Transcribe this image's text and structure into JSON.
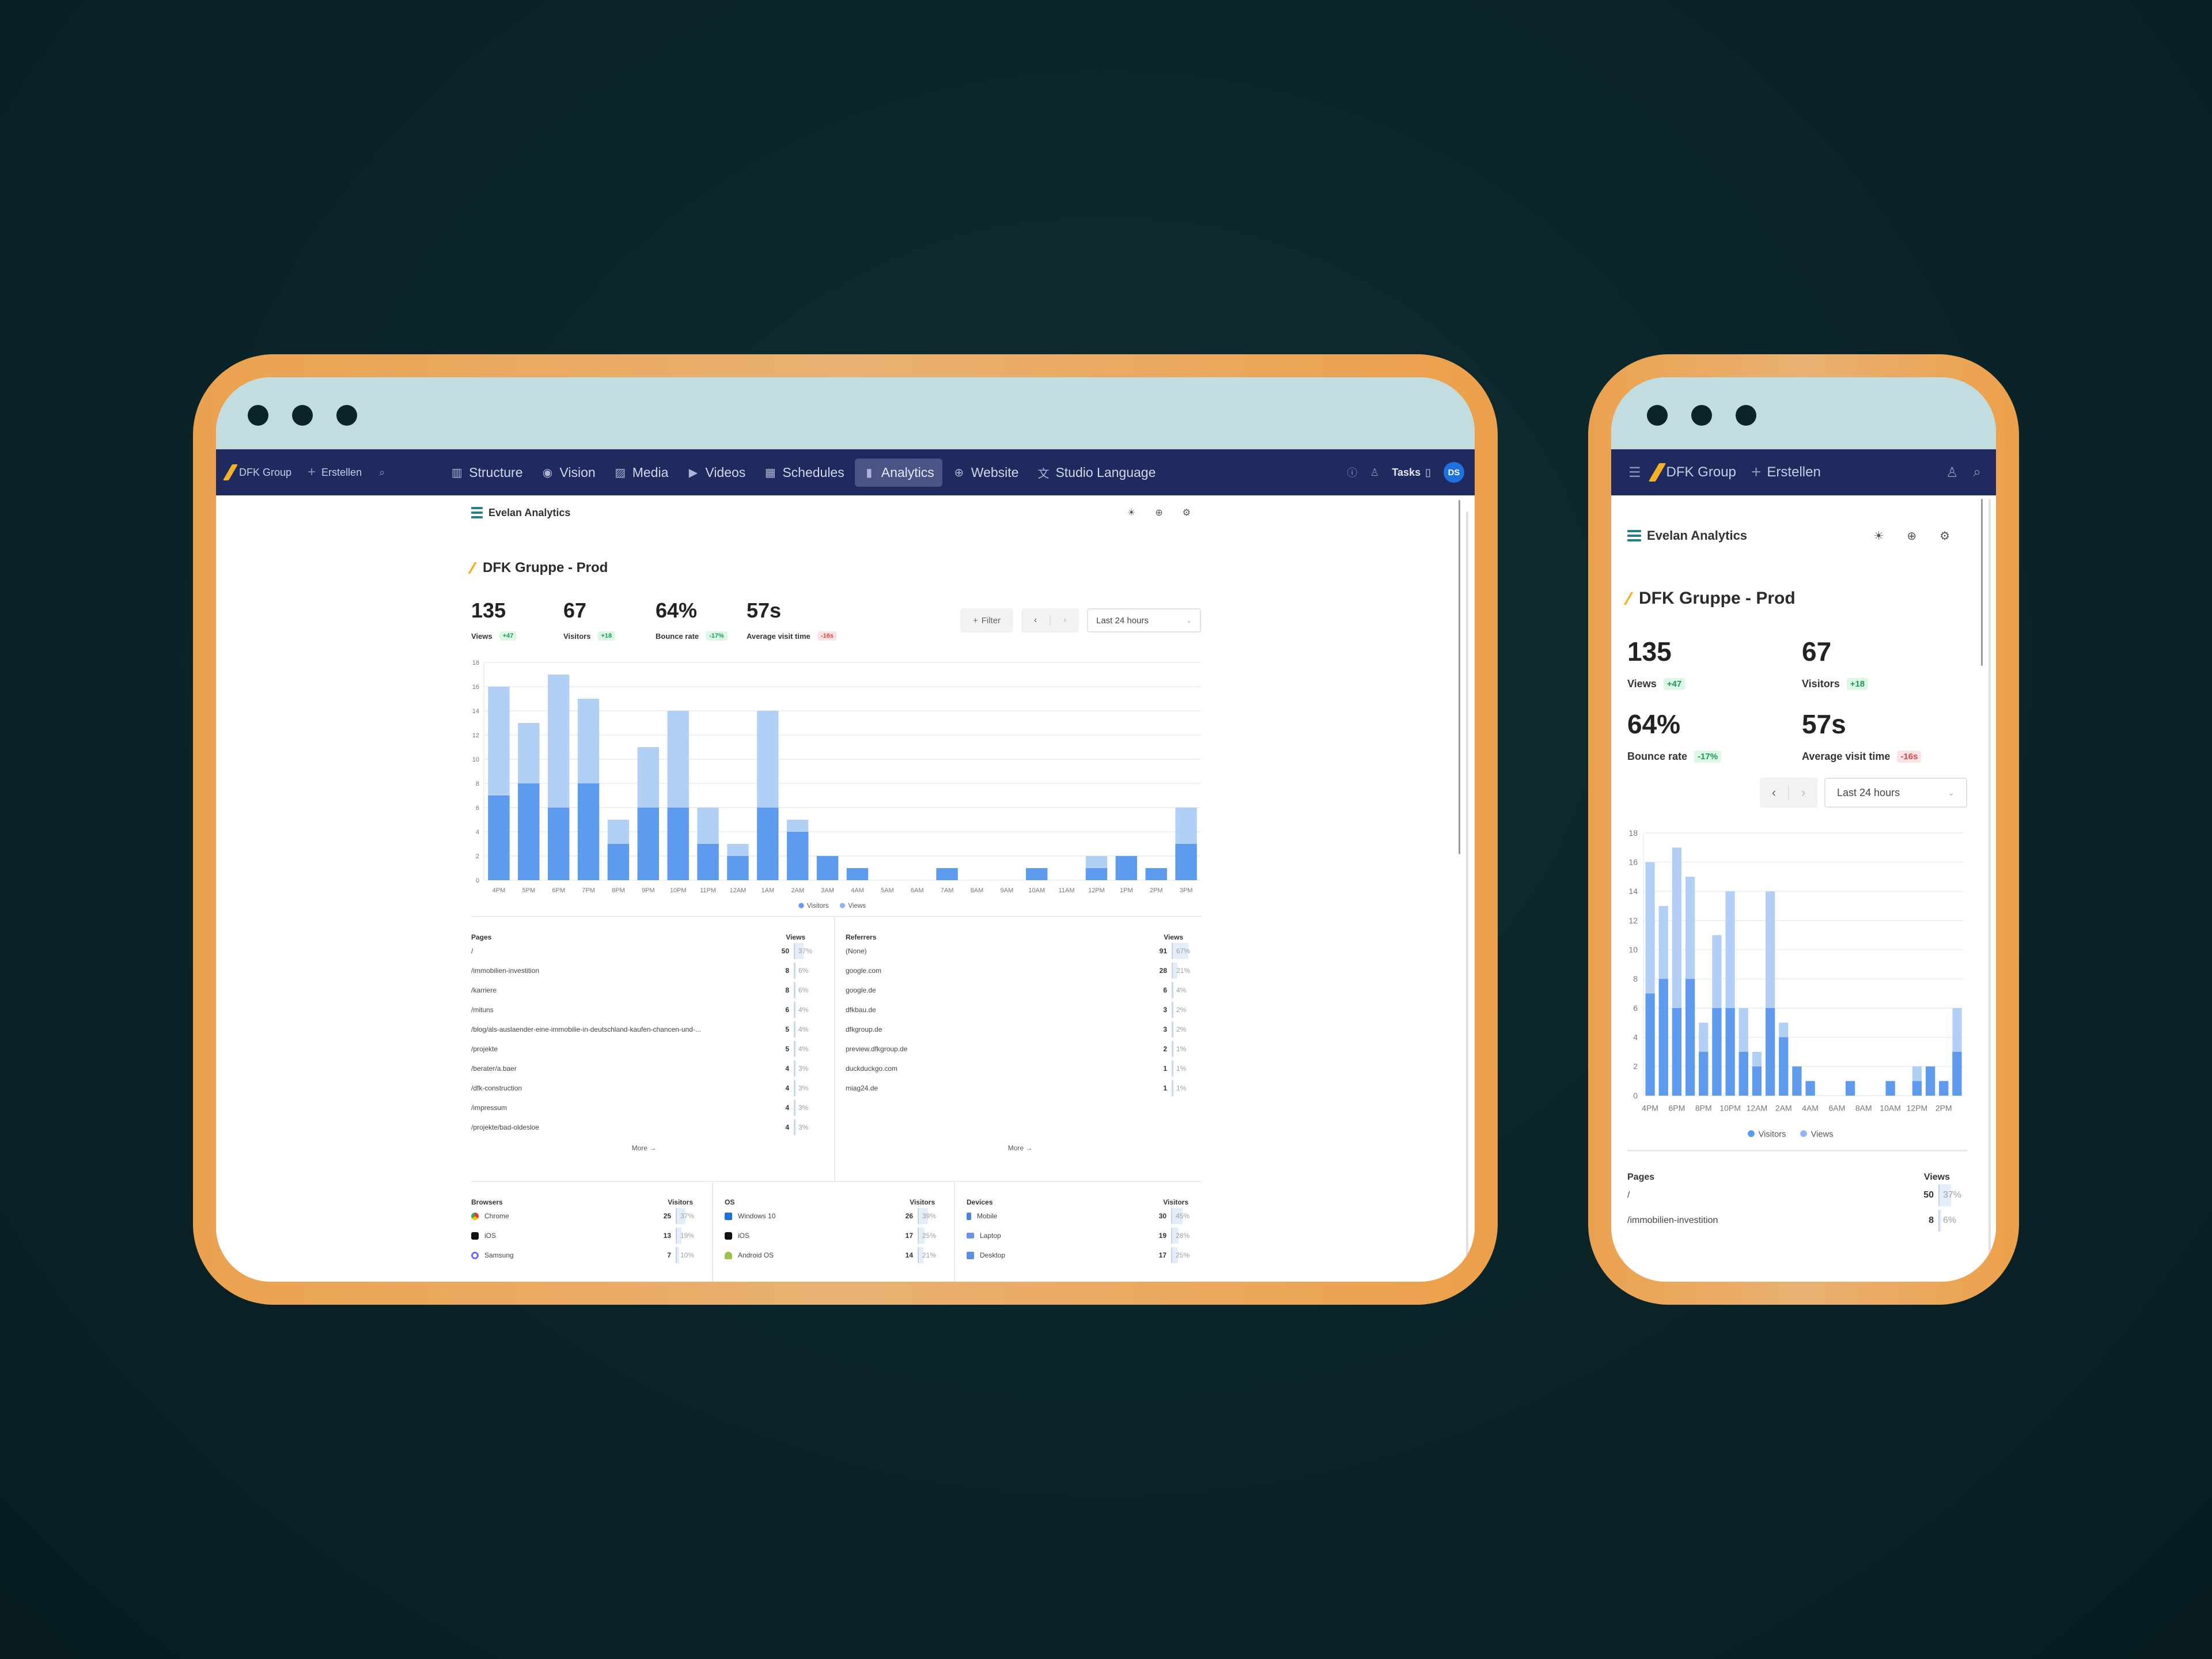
{
  "app": {
    "workspace": "DFK Group",
    "create_label": "Erstellen",
    "nav": [
      {
        "label": "Structure",
        "icon": "structure-icon",
        "glyph": "▥"
      },
      {
        "label": "Vision",
        "icon": "eye-icon",
        "glyph": "◉"
      },
      {
        "label": "Media",
        "icon": "image-icon",
        "glyph": "▨"
      },
      {
        "label": "Videos",
        "icon": "video-icon",
        "glyph": "▶"
      },
      {
        "label": "Schedules",
        "icon": "calendar-icon",
        "glyph": "▦"
      },
      {
        "label": "Analytics",
        "icon": "bar-chart-icon",
        "glyph": "▮",
        "active": true
      },
      {
        "label": "Website",
        "icon": "globe-icon",
        "glyph": "⊕"
      },
      {
        "label": "Studio Language",
        "icon": "translate-icon",
        "glyph": "文"
      }
    ],
    "tasks_label": "Tasks",
    "avatar_initials": "DS",
    "colors": {
      "navbar": "#1f2a5e",
      "accent_blue": "#1e6fe0",
      "brand_yellow": "#f5b025",
      "frame_orange": "#eba24f",
      "titlebar": "#c2dde0"
    }
  },
  "analytics": {
    "brand": "Evelan Analytics",
    "site_title": "DFK Gruppe - Prod",
    "metrics": [
      {
        "value": "135",
        "label": "Views",
        "delta": "+47",
        "trend": "up"
      },
      {
        "value": "67",
        "label": "Visitors",
        "delta": "+18",
        "trend": "up"
      },
      {
        "value": "64%",
        "label": "Bounce rate",
        "delta": "-17%",
        "trend": "up"
      },
      {
        "value": "57s",
        "label": "Average visit time",
        "delta": "-16s",
        "trend": "down"
      }
    ],
    "filter_label": "Filter",
    "date_range": "Last 24 hours",
    "pages": {
      "title": "Pages",
      "metric": "Views",
      "rows": [
        {
          "label": "/",
          "value": 50,
          "pct": "37%",
          "frac": 0.37
        },
        {
          "label": "/immobilien-investition",
          "value": 8,
          "pct": "6%",
          "frac": 0.06
        },
        {
          "label": "/karriere",
          "value": 8,
          "pct": "6%",
          "frac": 0.06
        },
        {
          "label": "/mituns",
          "value": 6,
          "pct": "4%",
          "frac": 0.04
        },
        {
          "label": "/blog/als-auslaender-eine-immobilie-in-deutschland-kaufen-chancen-und-...",
          "value": 5,
          "pct": "4%",
          "frac": 0.04
        },
        {
          "label": "/projekte",
          "value": 5,
          "pct": "4%",
          "frac": 0.04
        },
        {
          "label": "/berater/a.baer",
          "value": 4,
          "pct": "3%",
          "frac": 0.03
        },
        {
          "label": "/dfk-construction",
          "value": 4,
          "pct": "3%",
          "frac": 0.03
        },
        {
          "label": "/impressum",
          "value": 4,
          "pct": "3%",
          "frac": 0.03
        },
        {
          "label": "/projekte/bad-oldesloe",
          "value": 4,
          "pct": "3%",
          "frac": 0.03
        }
      ],
      "more": "More →"
    },
    "referrers": {
      "title": "Referrers",
      "metric": "Views",
      "rows": [
        {
          "label": "(None)",
          "value": 91,
          "pct": "67%",
          "frac": 0.67
        },
        {
          "label": "google.com",
          "value": 28,
          "pct": "21%",
          "frac": 0.21
        },
        {
          "label": "google.de",
          "value": 6,
          "pct": "4%",
          "frac": 0.04
        },
        {
          "label": "dfkbau.de",
          "value": 3,
          "pct": "2%",
          "frac": 0.02
        },
        {
          "label": "dfkgroup.de",
          "value": 3,
          "pct": "2%",
          "frac": 0.02
        },
        {
          "label": "preview.dfkgroup.de",
          "value": 2,
          "pct": "1%",
          "frac": 0.01
        },
        {
          "label": "duckduckgo.com",
          "value": 1,
          "pct": "1%",
          "frac": 0.01
        },
        {
          "label": "miag24.de",
          "value": 1,
          "pct": "1%",
          "frac": 0.01
        }
      ],
      "more": "More →"
    },
    "browsers": {
      "title": "Browsers",
      "metric": "Visitors",
      "rows": [
        {
          "label": "Chrome",
          "icon": "chrome-icon",
          "value": 25,
          "pct": "37%",
          "frac": 0.37
        },
        {
          "label": "iOS",
          "icon": "apple-icon",
          "value": 13,
          "pct": "19%",
          "frac": 0.19
        },
        {
          "label": "Samsung",
          "icon": "samsung-icon",
          "value": 7,
          "pct": "10%",
          "frac": 0.1
        }
      ]
    },
    "os": {
      "title": "OS",
      "metric": "Visitors",
      "rows": [
        {
          "label": "Windows 10",
          "icon": "windows-icon",
          "value": 26,
          "pct": "39%",
          "frac": 0.39
        },
        {
          "label": "iOS",
          "icon": "apple-icon",
          "value": 17,
          "pct": "25%",
          "frac": 0.25
        },
        {
          "label": "Android OS",
          "icon": "android-icon",
          "value": 14,
          "pct": "21%",
          "frac": 0.21
        }
      ]
    },
    "devices": {
      "title": "Devices",
      "metric": "Visitors",
      "rows": [
        {
          "label": "Mobile",
          "icon": "mobile-icon",
          "value": 30,
          "pct": "45%",
          "frac": 0.45
        },
        {
          "label": "Laptop",
          "icon": "laptop-icon",
          "value": 19,
          "pct": "28%",
          "frac": 0.28
        },
        {
          "label": "Desktop",
          "icon": "desktop-icon",
          "value": 17,
          "pct": "25%",
          "frac": 0.25
        }
      ]
    }
  },
  "chart_data": {
    "type": "bar",
    "stacked": "overlay",
    "title": "",
    "xlabel": "",
    "ylabel": "",
    "categories": [
      "4PM",
      "5PM",
      "6PM",
      "7PM",
      "8PM",
      "9PM",
      "10PM",
      "11PM",
      "12AM",
      "1AM",
      "2AM",
      "3AM",
      "4AM",
      "5AM",
      "6AM",
      "7AM",
      "8AM",
      "9AM",
      "10AM",
      "11AM",
      "12PM",
      "1PM",
      "2PM",
      "3PM"
    ],
    "series": [
      {
        "name": "Visitors",
        "color": "#5e9bef",
        "values": [
          7,
          8,
          6,
          8,
          3,
          6,
          6,
          3,
          2,
          6,
          4,
          2,
          1,
          0,
          0,
          1,
          0,
          0,
          1,
          0,
          1,
          2,
          1,
          3
        ]
      },
      {
        "name": "Views",
        "color": "#b2cff5",
        "values": [
          16,
          13,
          17,
          15,
          5,
          11,
          14,
          6,
          3,
          14,
          5,
          2,
          1,
          0,
          0,
          1,
          0,
          0,
          1,
          0,
          2,
          2,
          1,
          6
        ]
      }
    ],
    "ylim": [
      0,
      18
    ],
    "yticks": [
      0,
      2,
      4,
      6,
      8,
      10,
      12,
      14,
      16,
      18
    ],
    "grid": true,
    "legend": "bottom-center"
  }
}
